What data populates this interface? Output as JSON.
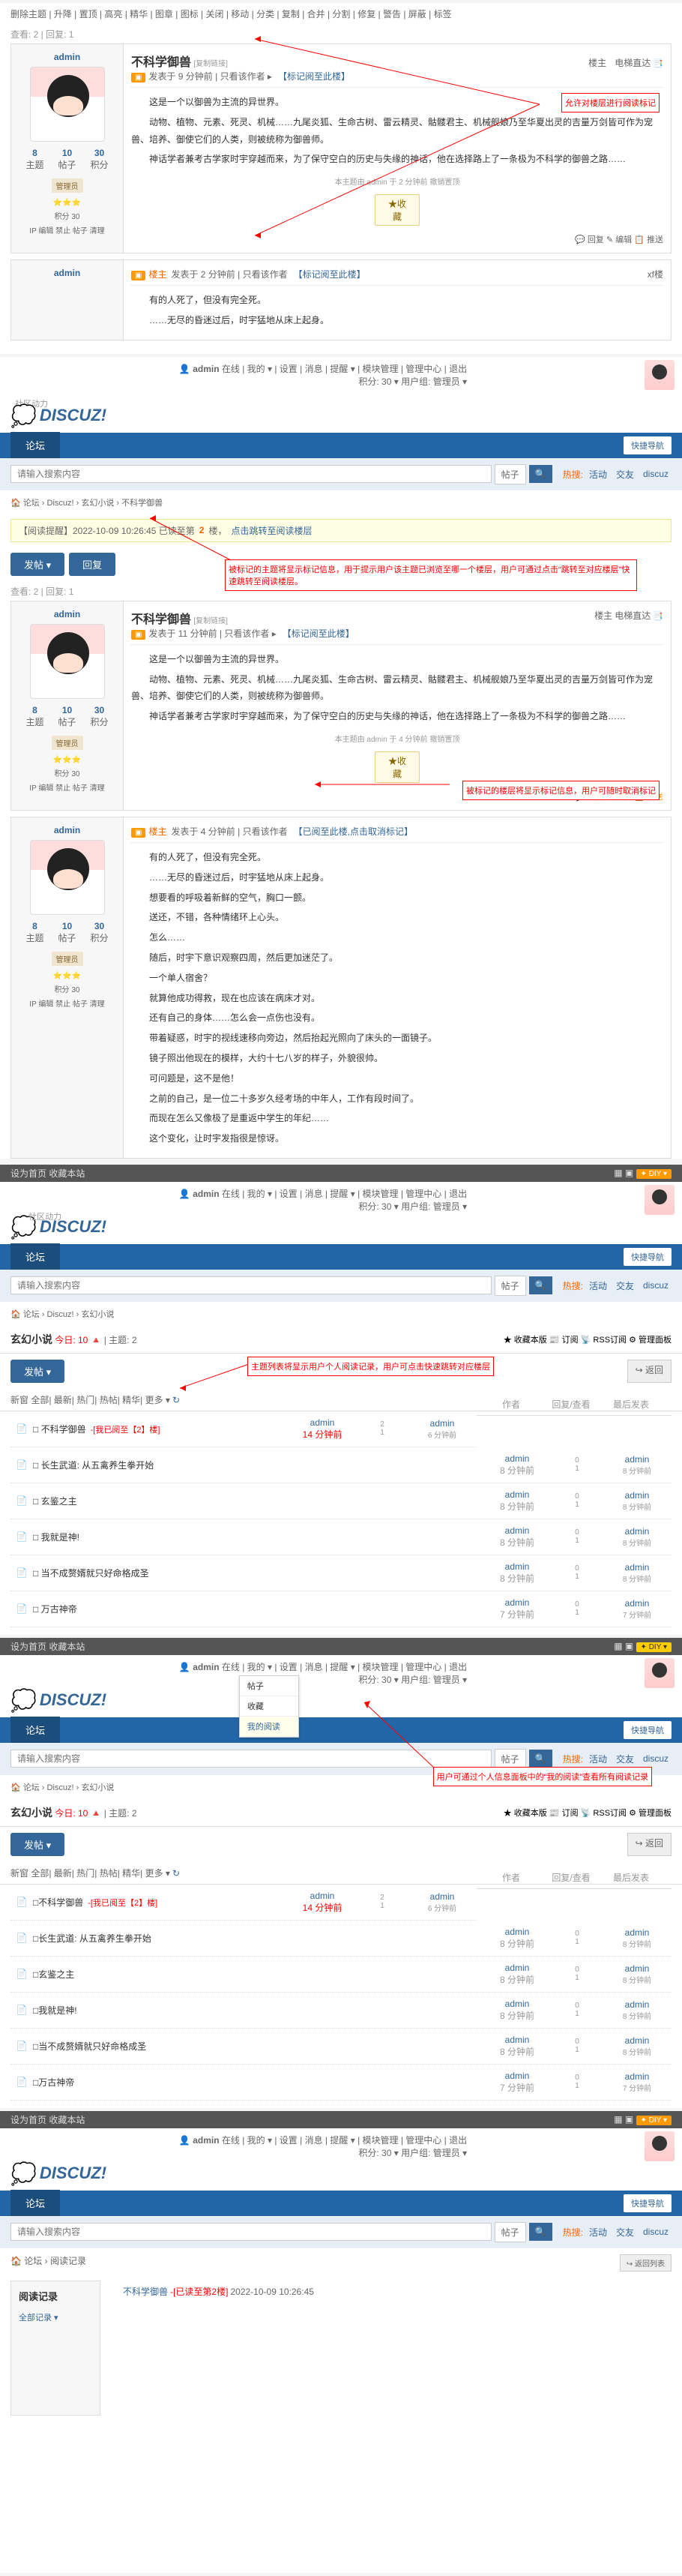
{
  "common": {
    "logo": "DISCUZ!",
    "logo_cn": "社区动力",
    "nav_forum": "论坛",
    "quick_nav": "快捷导航",
    "search_ph": "请输入搜索内容",
    "search_sel": "帖子",
    "search_icon": "🔍",
    "hot_label": "热搜:",
    "hot1": "活动",
    "hot2": "交友",
    "hot3": "discuz",
    "user": "admin",
    "hdr_links": "在线 | 我的 ▾ | 设置 | 消息 | 提醒 ▾ | 模块管理 | 管理中心 | 退出",
    "hdr_stats": "积分: 30 ▾    用户组: 管理员 ▾"
  },
  "s1": {
    "tabs": "删除主题 | 升降 | 置顶 | 高亮 | 精华 | 图章 | 图标 | 关闭 | 移动 | 分类 | 复制 | 合并 | 分割 | 修复 | 警告 | 屏蔽 | 标签",
    "stat": "查看: 2 | 回复: 1",
    "title": "不科学御兽",
    "sub": "[复制链接]",
    "floor_owner": "楼主",
    "jump": "电梯直达",
    "meta1": "发表于 9 分钟前 | 只看该作者 ▸",
    "mark1": "【标记阅至此楼】",
    "body1a": "这是一个以御兽为主流的异世界。",
    "body1b": "动物、植物、元素、死灵、机械……九尾炎狐、生命古树、雷云精灵、骷髅君主、机械舰娘乃至华夏出灵的吉量万剑皆可作为宠兽、培养、御使它们的人类，则被统称为御兽师。",
    "body1c": "神话学者兼考古学家时宇穿越而来，为了保守空白的历史与失缘的神话，他在选择路上了一条极为不科学的御兽之路……",
    "foot1": "本主题由 admin 于 2 分钟前 撤销置顶",
    "fav": "★收藏",
    "acts": "💬 回复   ✎ 编辑   📋 推送",
    "floor2": "楼主",
    "meta2": "发表于 2 分钟前 | 只看该作者",
    "mark2": "【标记阅至此楼】",
    "xf": "xf楼",
    "body2a": "有的人死了，但没有完全死。",
    "body2b": "……无尽的昏迷过后，时宇猛地从床上起身。",
    "side": {
      "stat_a": "8",
      "stat_b": "10",
      "stat_c": "30",
      "lbl_a": "主题",
      "lbl_b": "帖子",
      "lbl_c": "积分",
      "group": "管理员",
      "stars": "⭐⭐⭐",
      "jf": "积分 30",
      "ip": "IP 编辑 禁止 帖子 清理"
    },
    "ann1": "允许对楼层进行阅读标记"
  },
  "s2": {
    "bc": "🏠 论坛 › Discuz! › 玄幻小说 › 不科学御兽",
    "notice_pre": "【阅读提醒】2022-10-09 10:26:45 已读至第",
    "notice_n": "2",
    "notice_suf": "楼，",
    "notice_link": "点击跳转至阅读楼层",
    "btn_post": "发帖 ▾",
    "btn_reply": "回复",
    "stat": "查看: 2 | 回复: 1",
    "title": "不科学御兽",
    "sub": "[复制链接]",
    "meta1": "发表于 11 分钟前 | 只看该作者 ▸",
    "mark1": "【标记阅至此楼】",
    "foot1": "本主题由 admin 于 4 分钟前 撤销置顶",
    "meta2": "发表于 4 分钟前 | 只看该作者",
    "mark2": "【已阅至此楼,点击取消标记】",
    "b2a": "有的人死了，但没有完全死。",
    "b2b": "……无尽的昏迷过后，时宇猛地从床上起身。",
    "b2c": "想要看的呼吸着新鲜的空气，胸口一颤。",
    "b2d": "送还，不错，各种情绪环上心头。",
    "b2e": "怎么……",
    "b2f": "随后，时宇下意识观察四周，然后更加迷茫了。",
    "b2g": "一个单人宿舍？",
    "b2h": "就算他成功得救，现在也应该在病床才对。",
    "b2i": "还有自己的身体……怎么会一点伤也没有。",
    "b2j": "带着疑惑，时宇的视线速移向旁边，然后抬起光照向了床头的一面镜子。",
    "b2k": "镜子照出他现在的模样，大约十七八岁的样子，外貌很帅。",
    "b2l": "可问题是，这不是他！",
    "b2m": "之前的自己，是一位二十多岁久经考场的中年人，工作有段时间了。",
    "b2n": "而现在怎么又像极了是重返中学生的年纪……",
    "b2o": "这个变化，让时宇发指很是惊讶。",
    "ann2": "被标记的主题将显示标记信息，用于提示用户该主题已浏览至哪一个楼层，用户可通过点击“跳转至对应楼层”快速跳转至阅读楼层。",
    "ann3": "被标记的楼层将显示标记信息，用户可随时取消标记"
  },
  "s3": {
    "top_l": "设为首页  收藏本站",
    "bc": "🏠 论坛 › Discuz! › 玄幻小说",
    "forum": "玄幻小说",
    "today": "今日: 10 🔺",
    "threads": "| 主题: 2",
    "tools": "★ 收藏本版  📰 订阅  📡 RSS订阅  ⚙ 管理面板",
    "post": "发帖 ▾",
    "return": "↪ 返回",
    "tabs": "新窗 全部| 最新| 热门| 热帖| 精华| 更多 ▾",
    "refresh": "↻",
    "hdr_a": "作者",
    "hdr_b": "回复/查看",
    "hdr_c": "最后发表",
    "ann4": "主题列表将显示用户个人阅读记录，用户可点击快速跳转对应楼层",
    "rows": [
      {
        "t": "□ 不科学御兽",
        "mk": "-[我已阅至【2】楼]",
        "au": "admin",
        "at": "14 分钟前",
        "r": "2",
        "v": "1",
        "lu": "admin",
        "lt": "6 分钟前"
      },
      {
        "t": "□ 长生武道: 从五禽养生拳开始",
        "au": "admin",
        "at": "8 分钟前",
        "r": "0",
        "v": "1",
        "lu": "admin",
        "lt": "8 分钟前"
      },
      {
        "t": "□ 玄鉴之主",
        "au": "admin",
        "at": "8 分钟前",
        "r": "0",
        "v": "1",
        "lu": "admin",
        "lt": "8 分钟前"
      },
      {
        "t": "□ 我就是神!",
        "au": "admin",
        "at": "8 分钟前",
        "r": "0",
        "v": "1",
        "lu": "admin",
        "lt": "8 分钟前"
      },
      {
        "t": "□ 当不成赘婿就只好命格成圣",
        "au": "admin",
        "at": "8 分钟前",
        "r": "0",
        "v": "1",
        "lu": "admin",
        "lt": "8 分钟前"
      },
      {
        "t": "□ 万古神帝",
        "au": "admin",
        "at": "7 分钟前",
        "r": "0",
        "v": "1",
        "lu": "admin",
        "lt": "7 分钟前"
      }
    ]
  },
  "s4": {
    "diy": "✦ DIY ▾",
    "dd1": "帖子",
    "dd2": "收藏",
    "dd3": "我的阅读",
    "ann5": "用户可通过个人信息面板中的“我的阅读”查看所有阅读记录",
    "forum": "玄幻小说",
    "today": "今日: 10 🔺",
    "threads": "| 主题: 2",
    "rows": [
      {
        "t": "□不科学御兽",
        "mk": "-[我已阅至【2】楼]",
        "au": "admin",
        "at": "14 分钟前",
        "r": "2",
        "v": "1",
        "lu": "admin",
        "lt": "6 分钟前"
      },
      {
        "t": "□长生武道: 从五禽养生拳开始",
        "au": "admin",
        "at": "8 分钟前",
        "r": "0",
        "v": "1",
        "lu": "admin",
        "lt": "8 分钟前"
      },
      {
        "t": "□玄鉴之主",
        "au": "admin",
        "at": "8 分钟前",
        "r": "0",
        "v": "1",
        "lu": "admin",
        "lt": "8 分钟前"
      },
      {
        "t": "□我就是神!",
        "au": "admin",
        "at": "8 分钟前",
        "r": "0",
        "v": "1",
        "lu": "admin",
        "lt": "8 分钟前"
      },
      {
        "t": "□当不成赘婿就只好命格成圣",
        "au": "admin",
        "at": "8 分钟前",
        "r": "0",
        "v": "1",
        "lu": "admin",
        "lt": "8 分钟前"
      },
      {
        "t": "□万古神帝",
        "au": "admin",
        "at": "7 分钟前",
        "r": "0",
        "v": "1",
        "lu": "admin",
        "lt": "7 分钟前"
      }
    ]
  },
  "s5": {
    "bc": "🏠 论坛 › 阅读记录",
    "return": "↪ 返回列表",
    "side_ttl": "阅读记录",
    "side_all": "全部记录 ▾",
    "row_t": "不科学御兽",
    "row_mk": "-[已读至第2楼]",
    "row_time": "2022-10-09 10:26:45"
  }
}
